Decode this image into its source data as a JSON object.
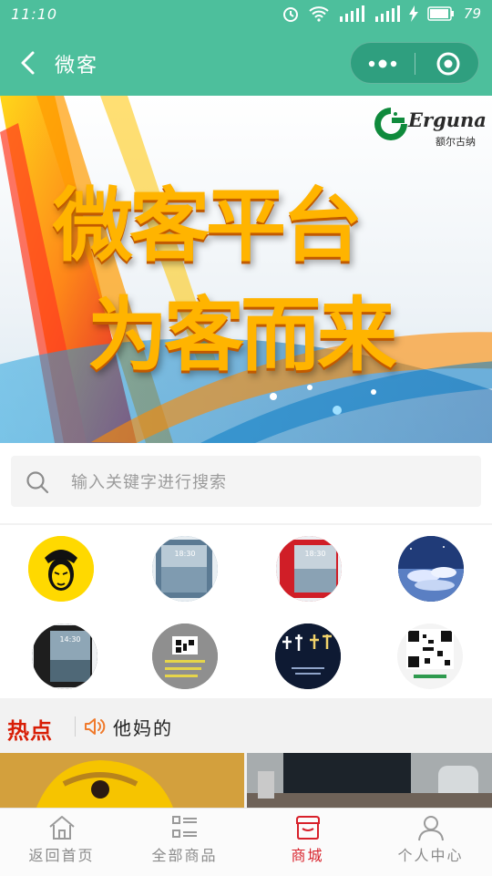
{
  "status": {
    "time": "11:10",
    "battery": "79",
    "network": "4G"
  },
  "nav": {
    "title": "微客"
  },
  "banner": {
    "line1": "微客平台",
    "line2": "为客而来",
    "brand_name": "Erguna",
    "brand_sub": "额尔古纳"
  },
  "search": {
    "placeholder": "输入关键字进行搜索",
    "value": ""
  },
  "categories": [
    {
      "icon": "monkey-king-icon"
    },
    {
      "icon": "phone-blue-icon"
    },
    {
      "icon": "phone-red-icon"
    },
    {
      "icon": "sky-clouds-icon"
    },
    {
      "icon": "phone-black-icon"
    },
    {
      "icon": "qr-poster-icon"
    },
    {
      "icon": "night-poster-icon"
    },
    {
      "icon": "qr-code-icon"
    }
  ],
  "hot": {
    "logo": "热点",
    "text": "他妈的"
  },
  "tabs": [
    {
      "label": "返回首页",
      "icon": "home-icon",
      "active": false
    },
    {
      "label": "全部商品",
      "icon": "list-icon",
      "active": false
    },
    {
      "label": "商城",
      "icon": "shop-icon",
      "active": true
    },
    {
      "label": "个人中心",
      "icon": "user-icon",
      "active": false
    }
  ],
  "colors": {
    "primary": "#4dbf9c",
    "active": "#d8202a",
    "hot": "#d81e06"
  }
}
